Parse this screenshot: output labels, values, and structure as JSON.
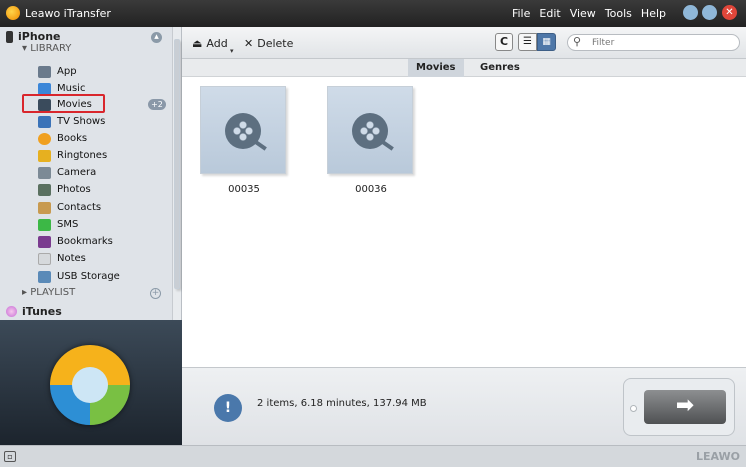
{
  "window": {
    "title": "Leawo iTransfer",
    "menu": [
      "File",
      "Edit",
      "View",
      "Tools",
      "Help"
    ]
  },
  "sidebar": {
    "device": "iPhone",
    "library_label": "LIBRARY",
    "items": [
      {
        "label": "App",
        "icon": "app-icon",
        "color": "#6a7a8c"
      },
      {
        "label": "Music",
        "icon": "music-icon",
        "color": "#3b86d8"
      },
      {
        "label": "Movies",
        "icon": "movies-icon",
        "color": "#3a4b5c"
      },
      {
        "label": "TV Shows",
        "icon": "tv-shows-icon",
        "color": "#3b73b8"
      },
      {
        "label": "Books",
        "icon": "books-icon",
        "color": "#f0a020"
      },
      {
        "label": "Ringtones",
        "icon": "ringtones-icon",
        "color": "#e6b020"
      },
      {
        "label": "Camera",
        "icon": "camera-icon",
        "color": "#7c8a96"
      },
      {
        "label": "Photos",
        "icon": "photos-icon",
        "color": "#5a7060"
      },
      {
        "label": "Contacts",
        "icon": "contacts-icon",
        "color": "#c89a50"
      },
      {
        "label": "SMS",
        "icon": "sms-icon",
        "color": "#3cb846"
      },
      {
        "label": "Bookmarks",
        "icon": "bookmarks-icon",
        "color": "#7a3b8f"
      },
      {
        "label": "Notes",
        "icon": "notes-icon",
        "color": "#d6d9dc"
      },
      {
        "label": "USB Storage",
        "icon": "usb-storage-icon",
        "color": "#5a8ab8"
      }
    ],
    "movies_badge": "+2",
    "playlist_label": "PLAYLIST",
    "itunes_label": "iTunes"
  },
  "toolbar": {
    "add_label": "Add",
    "delete_label": "Delete",
    "refresh_label": "C",
    "search_placeholder": "Filter"
  },
  "tabs": {
    "movies": "Movies",
    "genres": "Genres"
  },
  "content": {
    "items": [
      {
        "label": "00035"
      },
      {
        "label": "00036"
      }
    ]
  },
  "status": {
    "text": "2 items, 6.18 minutes, 137.94 MB"
  },
  "brand": "LEAWO"
}
